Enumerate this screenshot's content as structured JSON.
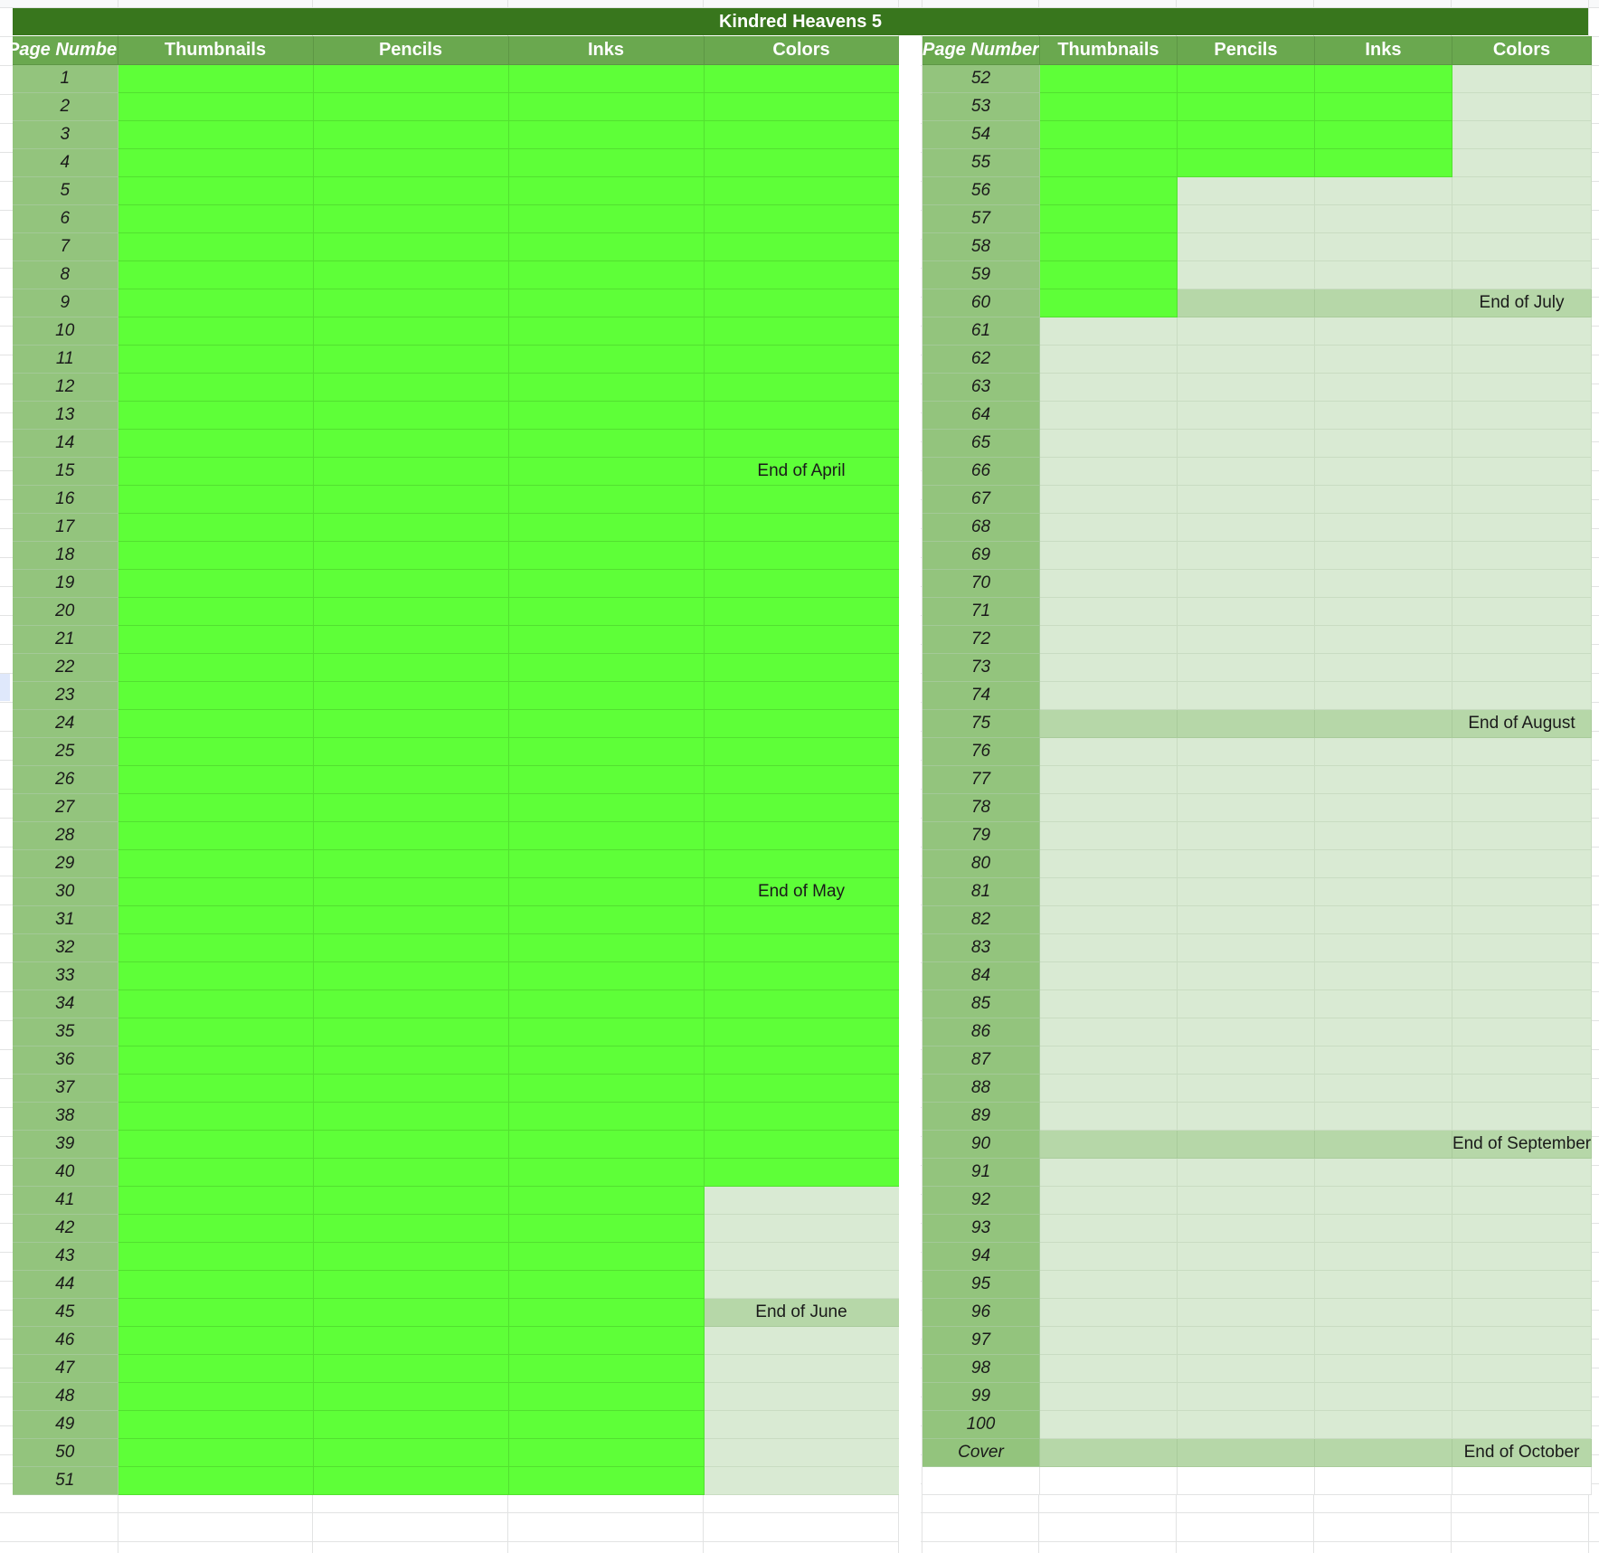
{
  "sheet": {
    "title": "Kindred Heavens 5",
    "left_headers": [
      "Page Numbe",
      "Thumbnails",
      "Pencils",
      "Inks",
      "Colors"
    ],
    "right_headers": [
      "Page Number",
      "Thumbnails",
      "Pencils",
      "Inks",
      "Colors"
    ],
    "colors": {
      "title_bg": "#38761d",
      "header_bg": "#6aa84f",
      "page_number_bg": "#93c47d",
      "done": "#5eff38",
      "todo": "#d9ead3",
      "month_row": "#b6d7a8"
    },
    "left_rows": [
      {
        "page": "1",
        "s": [
          "done",
          "done",
          "done",
          "done"
        ]
      },
      {
        "page": "2",
        "s": [
          "done",
          "done",
          "done",
          "done"
        ]
      },
      {
        "page": "3",
        "s": [
          "done",
          "done",
          "done",
          "done"
        ]
      },
      {
        "page": "4",
        "s": [
          "done",
          "done",
          "done",
          "done"
        ]
      },
      {
        "page": "5",
        "s": [
          "done",
          "done",
          "done",
          "done"
        ]
      },
      {
        "page": "6",
        "s": [
          "done",
          "done",
          "done",
          "done"
        ]
      },
      {
        "page": "7",
        "s": [
          "done",
          "done",
          "done",
          "done"
        ]
      },
      {
        "page": "8",
        "s": [
          "done",
          "done",
          "done",
          "done"
        ]
      },
      {
        "page": "9",
        "s": [
          "done",
          "done",
          "done",
          "done"
        ]
      },
      {
        "page": "10",
        "s": [
          "done",
          "done",
          "done",
          "done"
        ]
      },
      {
        "page": "11",
        "s": [
          "done",
          "done",
          "done",
          "done"
        ]
      },
      {
        "page": "12",
        "s": [
          "done",
          "done",
          "done",
          "done"
        ]
      },
      {
        "page": "13",
        "s": [
          "done",
          "done",
          "done",
          "done"
        ]
      },
      {
        "page": "14",
        "s": [
          "done",
          "done",
          "done",
          "done"
        ]
      },
      {
        "page": "15",
        "s": [
          "done",
          "done",
          "done",
          "done"
        ],
        "note": "End of April"
      },
      {
        "page": "16",
        "s": [
          "done",
          "done",
          "done",
          "done"
        ]
      },
      {
        "page": "17",
        "s": [
          "done",
          "done",
          "done",
          "done"
        ]
      },
      {
        "page": "18",
        "s": [
          "done",
          "done",
          "done",
          "done"
        ]
      },
      {
        "page": "19",
        "s": [
          "done",
          "done",
          "done",
          "done"
        ]
      },
      {
        "page": "20",
        "s": [
          "done",
          "done",
          "done",
          "done"
        ]
      },
      {
        "page": "21",
        "s": [
          "done",
          "done",
          "done",
          "done"
        ]
      },
      {
        "page": "22",
        "s": [
          "done",
          "done",
          "done",
          "done"
        ]
      },
      {
        "page": "23",
        "s": [
          "done",
          "done",
          "done",
          "done"
        ]
      },
      {
        "page": "24",
        "s": [
          "done",
          "done",
          "done",
          "done"
        ]
      },
      {
        "page": "25",
        "s": [
          "done",
          "done",
          "done",
          "done"
        ]
      },
      {
        "page": "26",
        "s": [
          "done",
          "done",
          "done",
          "done"
        ]
      },
      {
        "page": "27",
        "s": [
          "done",
          "done",
          "done",
          "done"
        ]
      },
      {
        "page": "28",
        "s": [
          "done",
          "done",
          "done",
          "done"
        ]
      },
      {
        "page": "29",
        "s": [
          "done",
          "done",
          "done",
          "done"
        ]
      },
      {
        "page": "30",
        "s": [
          "done",
          "done",
          "done",
          "done"
        ],
        "note": "End of May"
      },
      {
        "page": "31",
        "s": [
          "done",
          "done",
          "done",
          "done"
        ]
      },
      {
        "page": "32",
        "s": [
          "done",
          "done",
          "done",
          "done"
        ]
      },
      {
        "page": "33",
        "s": [
          "done",
          "done",
          "done",
          "done"
        ]
      },
      {
        "page": "34",
        "s": [
          "done",
          "done",
          "done",
          "done"
        ]
      },
      {
        "page": "35",
        "s": [
          "done",
          "done",
          "done",
          "done"
        ]
      },
      {
        "page": "36",
        "s": [
          "done",
          "done",
          "done",
          "done"
        ]
      },
      {
        "page": "37",
        "s": [
          "done",
          "done",
          "done",
          "done"
        ]
      },
      {
        "page": "38",
        "s": [
          "done",
          "done",
          "done",
          "done"
        ]
      },
      {
        "page": "39",
        "s": [
          "done",
          "done",
          "done",
          "done"
        ]
      },
      {
        "page": "40",
        "s": [
          "done",
          "done",
          "done",
          "done"
        ]
      },
      {
        "page": "41",
        "s": [
          "done",
          "done",
          "done",
          "todo"
        ]
      },
      {
        "page": "42",
        "s": [
          "done",
          "done",
          "done",
          "todo"
        ]
      },
      {
        "page": "43",
        "s": [
          "done",
          "done",
          "done",
          "todo"
        ]
      },
      {
        "page": "44",
        "s": [
          "done",
          "done",
          "done",
          "todo"
        ]
      },
      {
        "page": "45",
        "s": [
          "done",
          "done",
          "done",
          "month"
        ],
        "note": "End of June"
      },
      {
        "page": "46",
        "s": [
          "done",
          "done",
          "done",
          "todo"
        ]
      },
      {
        "page": "47",
        "s": [
          "done",
          "done",
          "done",
          "todo"
        ]
      },
      {
        "page": "48",
        "s": [
          "done",
          "done",
          "done",
          "todo"
        ]
      },
      {
        "page": "49",
        "s": [
          "done",
          "done",
          "done",
          "todo"
        ]
      },
      {
        "page": "50",
        "s": [
          "done",
          "done",
          "done",
          "todo"
        ]
      },
      {
        "page": "51",
        "s": [
          "done",
          "done",
          "done",
          "todo"
        ]
      }
    ],
    "right_rows": [
      {
        "page": "52",
        "s": [
          "done",
          "done",
          "done",
          "todo"
        ]
      },
      {
        "page": "53",
        "s": [
          "done",
          "done",
          "done",
          "todo"
        ]
      },
      {
        "page": "54",
        "s": [
          "done",
          "done",
          "done",
          "todo"
        ]
      },
      {
        "page": "55",
        "s": [
          "done",
          "done",
          "done",
          "todo"
        ]
      },
      {
        "page": "56",
        "s": [
          "done",
          "todo",
          "todo",
          "todo"
        ]
      },
      {
        "page": "57",
        "s": [
          "done",
          "todo",
          "todo",
          "todo"
        ]
      },
      {
        "page": "58",
        "s": [
          "done",
          "todo",
          "todo",
          "todo"
        ]
      },
      {
        "page": "59",
        "s": [
          "done",
          "todo",
          "todo",
          "todo"
        ]
      },
      {
        "page": "60",
        "s": [
          "done",
          "month",
          "month",
          "month"
        ],
        "note": "End of July"
      },
      {
        "page": "61",
        "s": [
          "todo",
          "todo",
          "todo",
          "todo"
        ]
      },
      {
        "page": "62",
        "s": [
          "todo",
          "todo",
          "todo",
          "todo"
        ]
      },
      {
        "page": "63",
        "s": [
          "todo",
          "todo",
          "todo",
          "todo"
        ]
      },
      {
        "page": "64",
        "s": [
          "todo",
          "todo",
          "todo",
          "todo"
        ]
      },
      {
        "page": "65",
        "s": [
          "todo",
          "todo",
          "todo",
          "todo"
        ]
      },
      {
        "page": "66",
        "s": [
          "todo",
          "todo",
          "todo",
          "todo"
        ]
      },
      {
        "page": "67",
        "s": [
          "todo",
          "todo",
          "todo",
          "todo"
        ]
      },
      {
        "page": "68",
        "s": [
          "todo",
          "todo",
          "todo",
          "todo"
        ]
      },
      {
        "page": "69",
        "s": [
          "todo",
          "todo",
          "todo",
          "todo"
        ]
      },
      {
        "page": "70",
        "s": [
          "todo",
          "todo",
          "todo",
          "todo"
        ]
      },
      {
        "page": "71",
        "s": [
          "todo",
          "todo",
          "todo",
          "todo"
        ]
      },
      {
        "page": "72",
        "s": [
          "todo",
          "todo",
          "todo",
          "todo"
        ]
      },
      {
        "page": "73",
        "s": [
          "todo",
          "todo",
          "todo",
          "todo"
        ]
      },
      {
        "page": "74",
        "s": [
          "todo",
          "todo",
          "todo",
          "todo"
        ]
      },
      {
        "page": "75",
        "s": [
          "month",
          "month",
          "month",
          "month"
        ],
        "note": "End of August"
      },
      {
        "page": "76",
        "s": [
          "todo",
          "todo",
          "todo",
          "todo"
        ]
      },
      {
        "page": "77",
        "s": [
          "todo",
          "todo",
          "todo",
          "todo"
        ]
      },
      {
        "page": "78",
        "s": [
          "todo",
          "todo",
          "todo",
          "todo"
        ]
      },
      {
        "page": "79",
        "s": [
          "todo",
          "todo",
          "todo",
          "todo"
        ]
      },
      {
        "page": "80",
        "s": [
          "todo",
          "todo",
          "todo",
          "todo"
        ]
      },
      {
        "page": "81",
        "s": [
          "todo",
          "todo",
          "todo",
          "todo"
        ]
      },
      {
        "page": "82",
        "s": [
          "todo",
          "todo",
          "todo",
          "todo"
        ]
      },
      {
        "page": "83",
        "s": [
          "todo",
          "todo",
          "todo",
          "todo"
        ]
      },
      {
        "page": "84",
        "s": [
          "todo",
          "todo",
          "todo",
          "todo"
        ]
      },
      {
        "page": "85",
        "s": [
          "todo",
          "todo",
          "todo",
          "todo"
        ]
      },
      {
        "page": "86",
        "s": [
          "todo",
          "todo",
          "todo",
          "todo"
        ]
      },
      {
        "page": "87",
        "s": [
          "todo",
          "todo",
          "todo",
          "todo"
        ]
      },
      {
        "page": "88",
        "s": [
          "todo",
          "todo",
          "todo",
          "todo"
        ]
      },
      {
        "page": "89",
        "s": [
          "todo",
          "todo",
          "todo",
          "todo"
        ]
      },
      {
        "page": "90",
        "s": [
          "month",
          "month",
          "month",
          "month"
        ],
        "note": "End of September"
      },
      {
        "page": "91",
        "s": [
          "todo",
          "todo",
          "todo",
          "todo"
        ]
      },
      {
        "page": "92",
        "s": [
          "todo",
          "todo",
          "todo",
          "todo"
        ]
      },
      {
        "page": "93",
        "s": [
          "todo",
          "todo",
          "todo",
          "todo"
        ]
      },
      {
        "page": "94",
        "s": [
          "todo",
          "todo",
          "todo",
          "todo"
        ]
      },
      {
        "page": "95",
        "s": [
          "todo",
          "todo",
          "todo",
          "todo"
        ]
      },
      {
        "page": "96",
        "s": [
          "todo",
          "todo",
          "todo",
          "todo"
        ]
      },
      {
        "page": "97",
        "s": [
          "todo",
          "todo",
          "todo",
          "todo"
        ]
      },
      {
        "page": "98",
        "s": [
          "todo",
          "todo",
          "todo",
          "todo"
        ]
      },
      {
        "page": "99",
        "s": [
          "todo",
          "todo",
          "todo",
          "todo"
        ]
      },
      {
        "page": "100",
        "s": [
          "todo",
          "todo",
          "todo",
          "todo"
        ]
      },
      {
        "page": "Cover",
        "s": [
          "month",
          "month",
          "month",
          "month"
        ],
        "note": "End of October"
      },
      {
        "page": "",
        "s": [
          "blank",
          "blank",
          "blank",
          "blank"
        ],
        "blank": true
      }
    ]
  }
}
